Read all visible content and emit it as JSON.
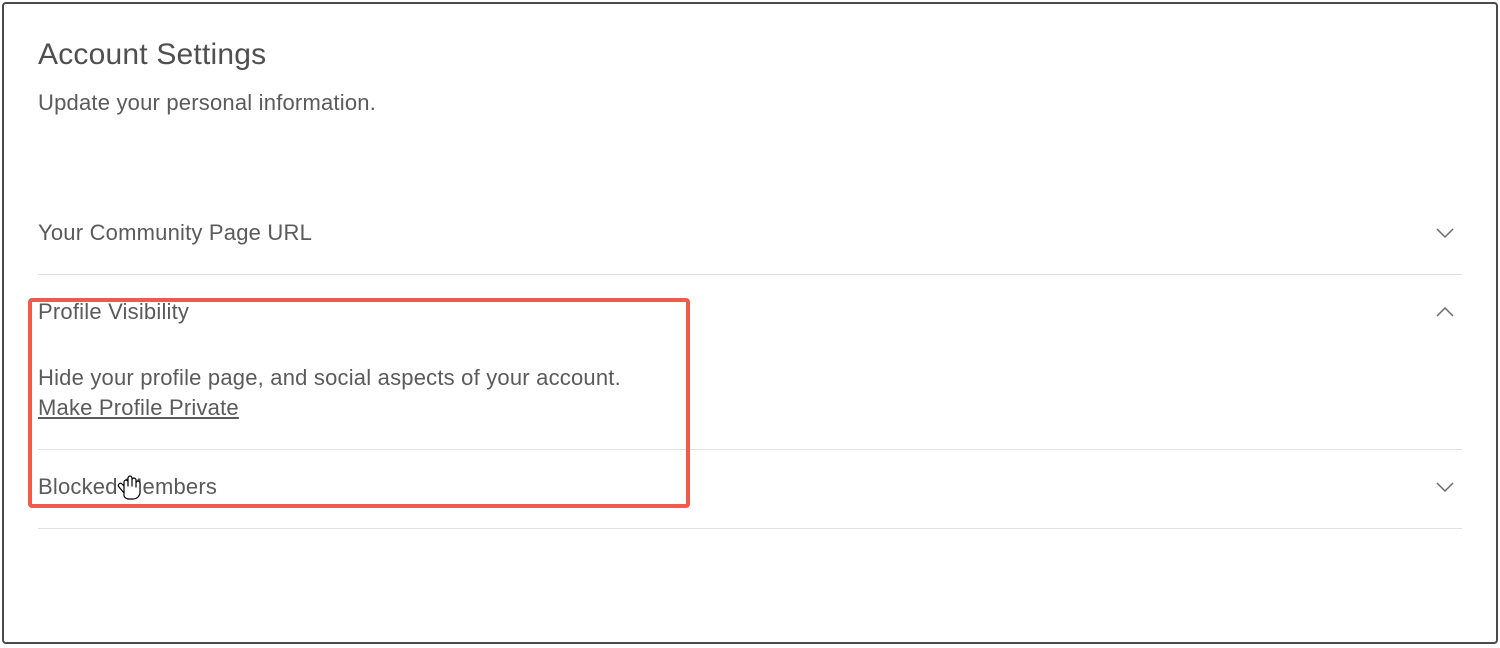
{
  "page": {
    "title": "Account Settings",
    "subtitle": "Update your personal information."
  },
  "sections": {
    "community_url": {
      "title": "Your Community Page URL",
      "expanded": false
    },
    "profile_visibility": {
      "title": "Profile Visibility",
      "expanded": true,
      "description": "Hide your profile page, and social aspects of your account.",
      "link_label": "Make Profile Private"
    },
    "blocked_members": {
      "title": "Blocked Members",
      "expanded": false
    }
  }
}
